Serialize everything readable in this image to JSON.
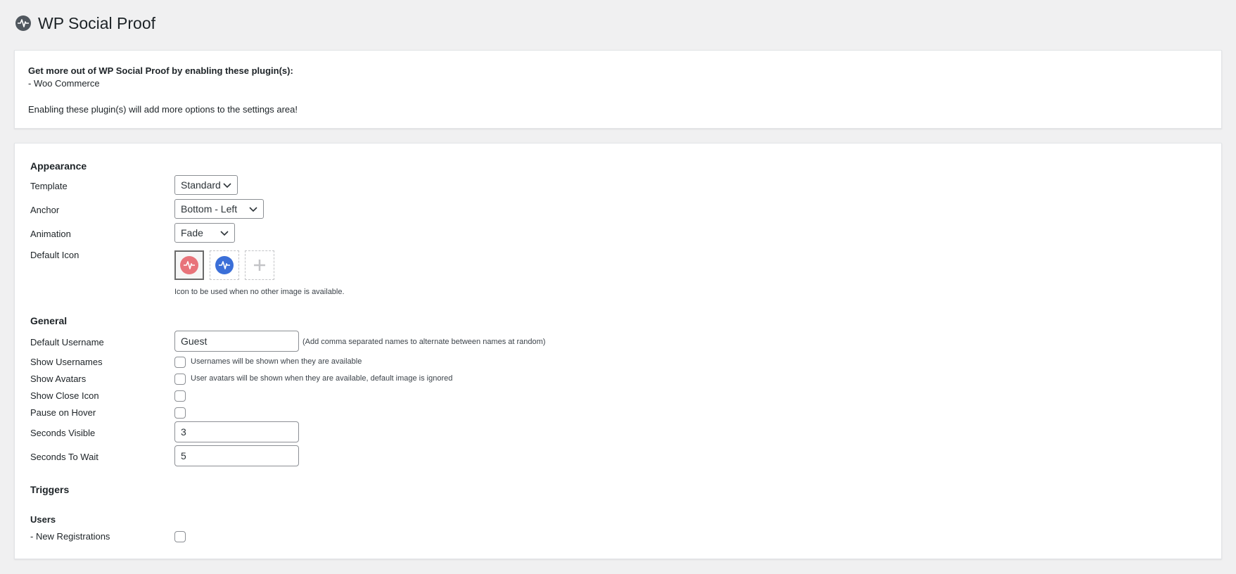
{
  "header": {
    "title": "WP Social Proof",
    "logo_icon": "pulse-icon"
  },
  "notice": {
    "title": "Get more out of WP Social Proof by enabling these plugin(s):",
    "item": "- Woo Commerce",
    "footer": "Enabling these plugin(s) will add more options to the settings area!"
  },
  "appearance": {
    "heading": "Appearance",
    "template_label": "Template",
    "template_value": "Standard",
    "anchor_label": "Anchor",
    "anchor_value": "Bottom - Left",
    "animation_label": "Animation",
    "animation_value": "Fade",
    "default_icon_label": "Default Icon",
    "icon_options": [
      {
        "name": "red-pulse-icon",
        "color": "#e8737a",
        "selected": true
      },
      {
        "name": "blue-pulse-icon",
        "color": "#3b6fd8",
        "selected": false
      }
    ],
    "add_icon": "plus-icon",
    "icon_hint": "Icon to be used when no other image is available."
  },
  "general": {
    "heading": "General",
    "default_username_label": "Default Username",
    "default_username_value": "Guest",
    "default_username_hint": "(Add comma separated names to alternate between names at random)",
    "show_usernames_label": "Show Usernames",
    "show_usernames_desc": "Usernames will be shown when they are available",
    "show_avatars_label": "Show Avatars",
    "show_avatars_desc": "User avatars will be shown when they are available, default image is ignored",
    "show_close_icon_label": "Show Close Icon",
    "pause_on_hover_label": "Pause on Hover",
    "seconds_visible_label": "Seconds Visible",
    "seconds_visible_value": "3",
    "seconds_to_wait_label": "Seconds To Wait",
    "seconds_to_wait_value": "5"
  },
  "triggers": {
    "heading": "Triggers",
    "users_heading": "Users",
    "new_registrations_label": "- New Registrations"
  }
}
